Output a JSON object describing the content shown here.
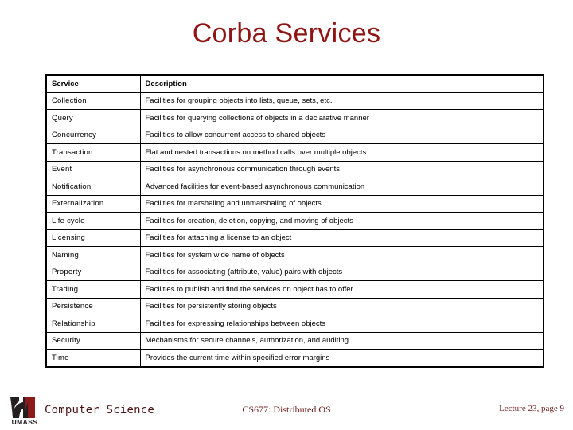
{
  "slide": {
    "title": "Corba Services",
    "title_color": "#8f1414",
    "background_color": "#ffffff"
  },
  "table": {
    "columns": [
      "Service",
      "Description"
    ],
    "rows": [
      {
        "service": "Collection",
        "description": "Facilities for grouping objects into lists, queue, sets, etc."
      },
      {
        "service": "Query",
        "description": "Facilities for querying collections of objects in a declarative manner"
      },
      {
        "service": "Concurrency",
        "description": "Facilities to allow concurrent access to shared objects"
      },
      {
        "service": "Transaction",
        "description": "Flat and nested transactions on method calls over multiple objects"
      },
      {
        "service": "Event",
        "description": "Facilities for asynchronous communication through events"
      },
      {
        "service": "Notification",
        "description": "Advanced facilities for event-based asynchronous communication"
      },
      {
        "service": "Externalization",
        "description": "Facilities for marshaling and unmarshaling of objects"
      },
      {
        "service": "Life cycle",
        "description": "Facilities for creation, deletion, copying, and moving of objects"
      },
      {
        "service": "Licensing",
        "description": "Facilities for attaching a license to an object"
      },
      {
        "service": "Naming",
        "description": "Facilities for system wide name of objects"
      },
      {
        "service": "Property",
        "description": "Facilities for associating (attribute, value) pairs with objects"
      },
      {
        "service": "Trading",
        "description": "Facilities to publish and find the services on object has to offer"
      },
      {
        "service": "Persistence",
        "description": "Facilities for persistently storing objects"
      },
      {
        "service": "Relationship",
        "description": "Facilities for expressing relationships between objects"
      },
      {
        "service": "Security",
        "description": "Mechanisms for secure channels, authorization, and auditing"
      },
      {
        "service": "Time",
        "description": "Provides the current time within specified error margins"
      }
    ]
  },
  "footer": {
    "logo_text": "UMASS",
    "logo_color": "#8b1a1a",
    "department": "Computer Science",
    "course": "CS677: Distributed OS",
    "page_info": "Lecture 23, page 9"
  }
}
